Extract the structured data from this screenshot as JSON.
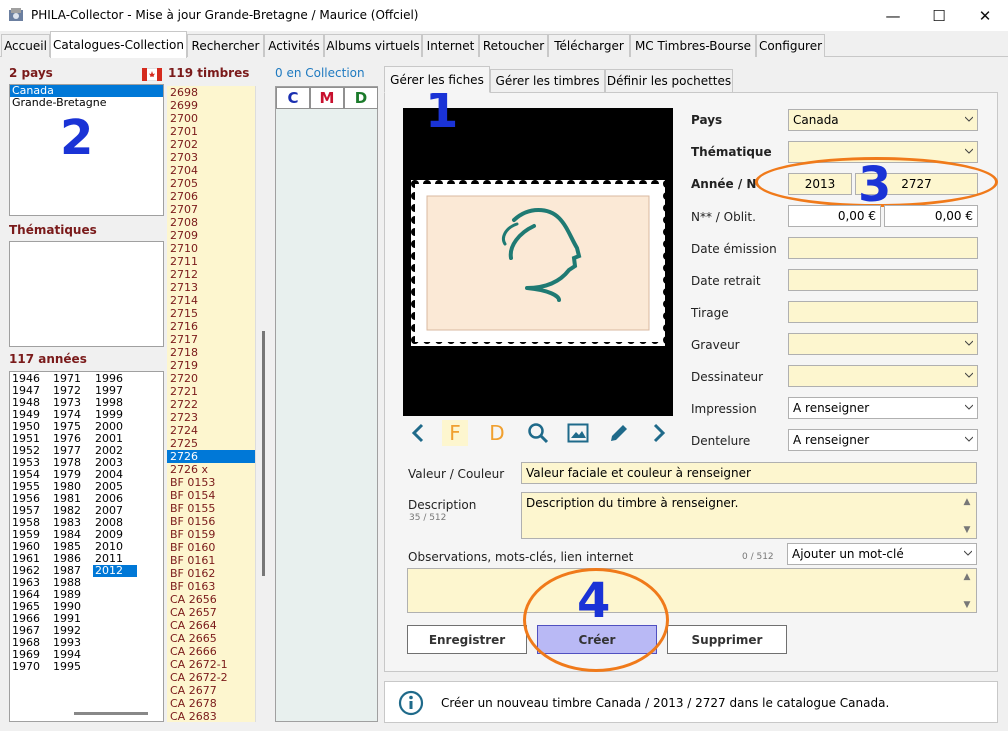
{
  "window": {
    "title": "PHILA-Collector - Mise à jour Grande-Bretagne / Maurice (Offciel)",
    "minimize": "—",
    "maximize": "☐",
    "close": "✕"
  },
  "tabs": [
    "Accueil",
    "Catalogues-Collection",
    "Rechercher",
    "Activités",
    "Albums virtuels",
    "Internet",
    "Retoucher",
    "Télécharger",
    "MC Timbres-Bourse",
    "Configurer"
  ],
  "left": {
    "countries_header": "2 pays",
    "countries": [
      "Canada",
      "Grande-Bretagne"
    ],
    "themes_header": "Thématiques",
    "years_header": "117 années",
    "years_col1": [
      "1946",
      "1947",
      "1948",
      "1949",
      "1950",
      "1951",
      "1952",
      "1953",
      "1954",
      "1955",
      "1956",
      "1957",
      "1958",
      "1959",
      "1960",
      "1961",
      "1962",
      "1963",
      "1964",
      "1965",
      "1966",
      "1967",
      "1968",
      "1969",
      "1970"
    ],
    "years_col2": [
      "1971",
      "1972",
      "1973",
      "1974",
      "1975",
      "1976",
      "1977",
      "1978",
      "1979",
      "1980",
      "1981",
      "1982",
      "1983",
      "1984",
      "1985",
      "1986",
      "1987",
      "1988",
      "1989",
      "1990",
      "1991",
      "1992",
      "1993",
      "1994",
      "1995"
    ],
    "years_col3": [
      "1996",
      "1997",
      "1998",
      "1999",
      "2000",
      "2001",
      "2002",
      "2003",
      "2004",
      "2005",
      "2006",
      "2007",
      "2008",
      "2009",
      "2010",
      "2011",
      "2012"
    ],
    "selected_year": "2012"
  },
  "stamps": {
    "header": "119 timbres",
    "items": [
      "2698",
      "2699",
      "2700",
      "2701",
      "2702",
      "2703",
      "2704",
      "2705",
      "2706",
      "2707",
      "2708",
      "2709",
      "2710",
      "2711",
      "2712",
      "2713",
      "2714",
      "2715",
      "2716",
      "2717",
      "2718",
      "2719",
      "2720",
      "2721",
      "2722",
      "2723",
      "2724",
      "2725",
      "2726",
      "2726 x",
      "BF 0153",
      "BF 0154",
      "BF 0155",
      "BF 0156",
      "BF 0159",
      "BF 0160",
      "BF 0161",
      "BF 0162",
      "BF 0163",
      "CA 2656",
      "CA 2657",
      "CA 2664",
      "CA 2665",
      "CA 2666",
      "CA 2672-1",
      "CA 2672-2",
      "CA 2677",
      "CA 2678",
      "CA 2683"
    ],
    "selected": "2726"
  },
  "collection": {
    "header": "0 en Collection",
    "buttons": [
      "C",
      "M",
      "D"
    ]
  },
  "subtabs": [
    "Gérer les fiches",
    "Gérer les timbres",
    "Définir les pochettes"
  ],
  "form": {
    "pays_label": "Pays",
    "pays_value": "Canada",
    "theme_label": "Thématique",
    "theme_value": "",
    "annee_label": "Année / N",
    "annee_value": "2013",
    "numero_value": "2727",
    "nstar_label": "N** / Oblit.",
    "neuf_value": "0,00 €",
    "oblit_value": "0,00 €",
    "date_emission_label": "Date émission",
    "date_retrait_label": "Date retrait",
    "tirage_label": "Tirage",
    "graveur_label": "Graveur",
    "dessinateur_label": "Dessinateur",
    "impression_label": "Impression",
    "impression_value": "A renseigner",
    "dentelure_label": "Dentelure",
    "dentelure_value": "A renseigner",
    "valeur_label": "Valeur / Couleur",
    "valeur_value": "Valeur faciale et couleur à renseigner",
    "description_label": "Description",
    "description_count": "35 / 512",
    "description_value": "Description du timbre à renseigner.",
    "observations_label": "Observations, mots-clés, lien internet",
    "observations_count": "0 / 512",
    "motcle_value": "Ajouter un mot-clé"
  },
  "toolbar": {
    "f": "F",
    "d": "D"
  },
  "buttons": {
    "save": "Enregistrer",
    "create": "Créer",
    "delete": "Supprimer"
  },
  "status": {
    "message": "Créer un nouveau timbre Canada / 2013 / 2727 dans le catalogue Canada."
  },
  "annotations": [
    "1",
    "2",
    "3",
    "4"
  ],
  "colors": {
    "accent": "#0078d7",
    "field": "#fdf6cf",
    "annotation_blue": "#1a33d6",
    "annotation_orange": "#f07a1a",
    "stamp_teal": "#1f7a73"
  }
}
